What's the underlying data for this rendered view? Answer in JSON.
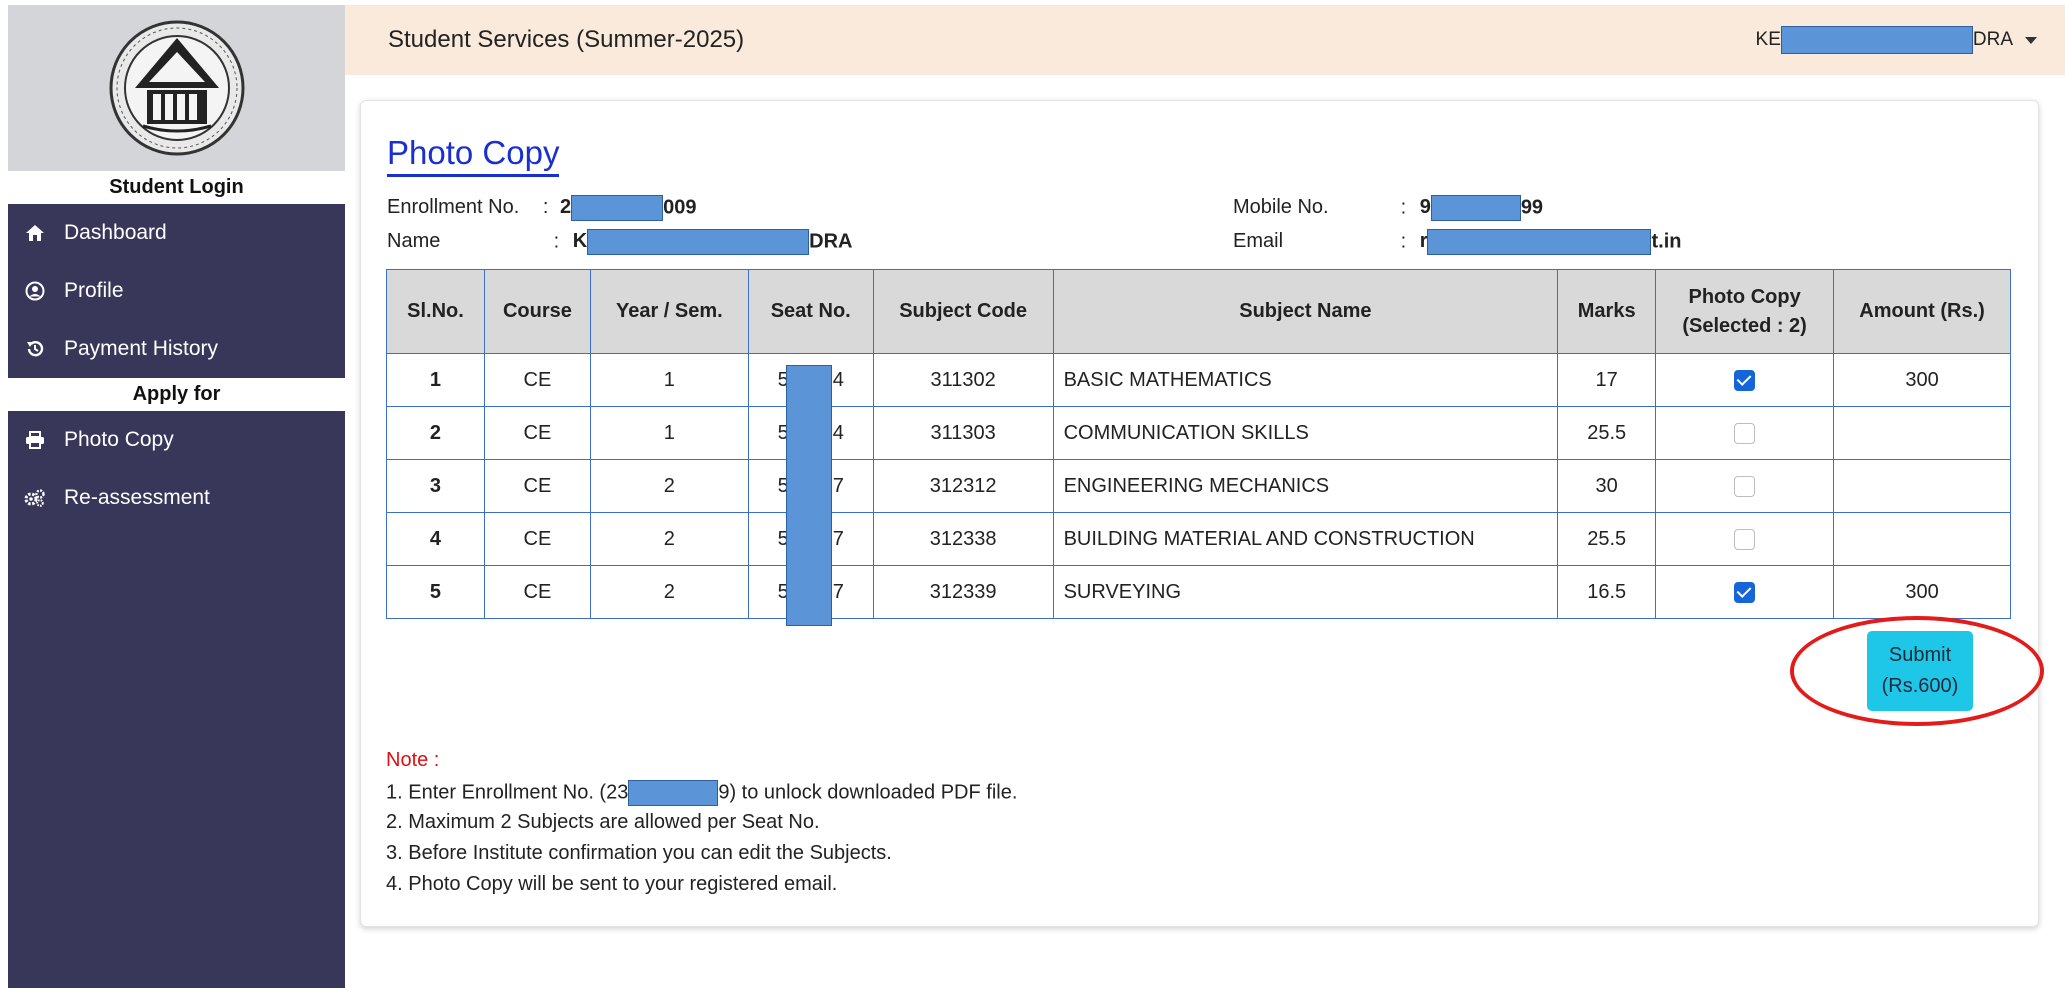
{
  "sidebar": {
    "login_heading": "Student Login",
    "items_top": [
      {
        "label": "Dashboard",
        "icon": "home-icon"
      },
      {
        "label": "Profile",
        "icon": "user-circle-icon"
      },
      {
        "label": "Payment History",
        "icon": "history-icon"
      }
    ],
    "apply_heading": "Apply for",
    "items_apply": [
      {
        "label": "Photo Copy",
        "icon": "printer-icon"
      },
      {
        "label": "Re-assessment",
        "icon": "gears-icon"
      }
    ]
  },
  "header": {
    "title": "Student Services (Summer-2025)",
    "user_prefix": "KE",
    "user_suffix": "DRA"
  },
  "page": {
    "title": "Photo Copy",
    "enrollment_label": "Enrollment No.",
    "enrollment_prefix": "2",
    "enrollment_suffix": "009",
    "name_label": "Name",
    "name_prefix": "K",
    "name_suffix": "DRA",
    "mobile_label": "Mobile No.",
    "mobile_prefix": "9",
    "mobile_suffix": "99",
    "email_label": "Email",
    "email_prefix": "r",
    "email_suffix": "t.in",
    "colon": ":"
  },
  "table": {
    "headers": [
      "Sl.No.",
      "Course",
      "Year / Sem.",
      "Seat No.",
      "Subject Code",
      "Subject Name",
      "Marks",
      "Photo Copy",
      "Amount (Rs.)"
    ],
    "photo_copy_selected": "(Selected : 2)",
    "rows": [
      {
        "sl": "1",
        "course": "CE",
        "year": "1",
        "seat_a": "5",
        "seat_b": "4",
        "code": "311302",
        "name": "BASIC MATHEMATICS",
        "marks": "17",
        "checked": true,
        "amount": "300"
      },
      {
        "sl": "2",
        "course": "CE",
        "year": "1",
        "seat_a": "5",
        "seat_b": "4",
        "code": "311303",
        "name": "COMMUNICATION SKILLS",
        "marks": "25.5",
        "checked": false,
        "amount": ""
      },
      {
        "sl": "3",
        "course": "CE",
        "year": "2",
        "seat_a": "5",
        "seat_b": "7",
        "code": "312312",
        "name": "ENGINEERING MECHANICS",
        "marks": "30",
        "checked": false,
        "amount": ""
      },
      {
        "sl": "4",
        "course": "CE",
        "year": "2",
        "seat_a": "5",
        "seat_b": "7",
        "code": "312338",
        "name": "BUILDING MATERIAL AND CONSTRUCTION",
        "marks": "25.5",
        "checked": false,
        "amount": ""
      },
      {
        "sl": "5",
        "course": "CE",
        "year": "2",
        "seat_a": "5",
        "seat_b": "7",
        "code": "312339",
        "name": "SURVEYING",
        "marks": "16.5",
        "checked": true,
        "amount": "300"
      }
    ]
  },
  "submit": {
    "line1": "Submit",
    "line2": "(Rs.600)"
  },
  "notes": {
    "title": "Note :",
    "line1_a": "1. Enter Enrollment No. (23",
    "line1_b": "9) to unlock downloaded PDF file.",
    "line2": "2. Maximum 2 Subjects are allowed per Seat No.",
    "line3": "3. Before Institute confirmation you can edit the Subjects.",
    "line4": "4. Photo Copy will be sent to your registered email."
  },
  "colors": {
    "sidebar": "#38375a",
    "topbar": "#faeadb",
    "title": "#1a2fd0",
    "submit": "#1ec6e8",
    "highlight": "#e31b1b",
    "table_border": "#3a70c9"
  }
}
